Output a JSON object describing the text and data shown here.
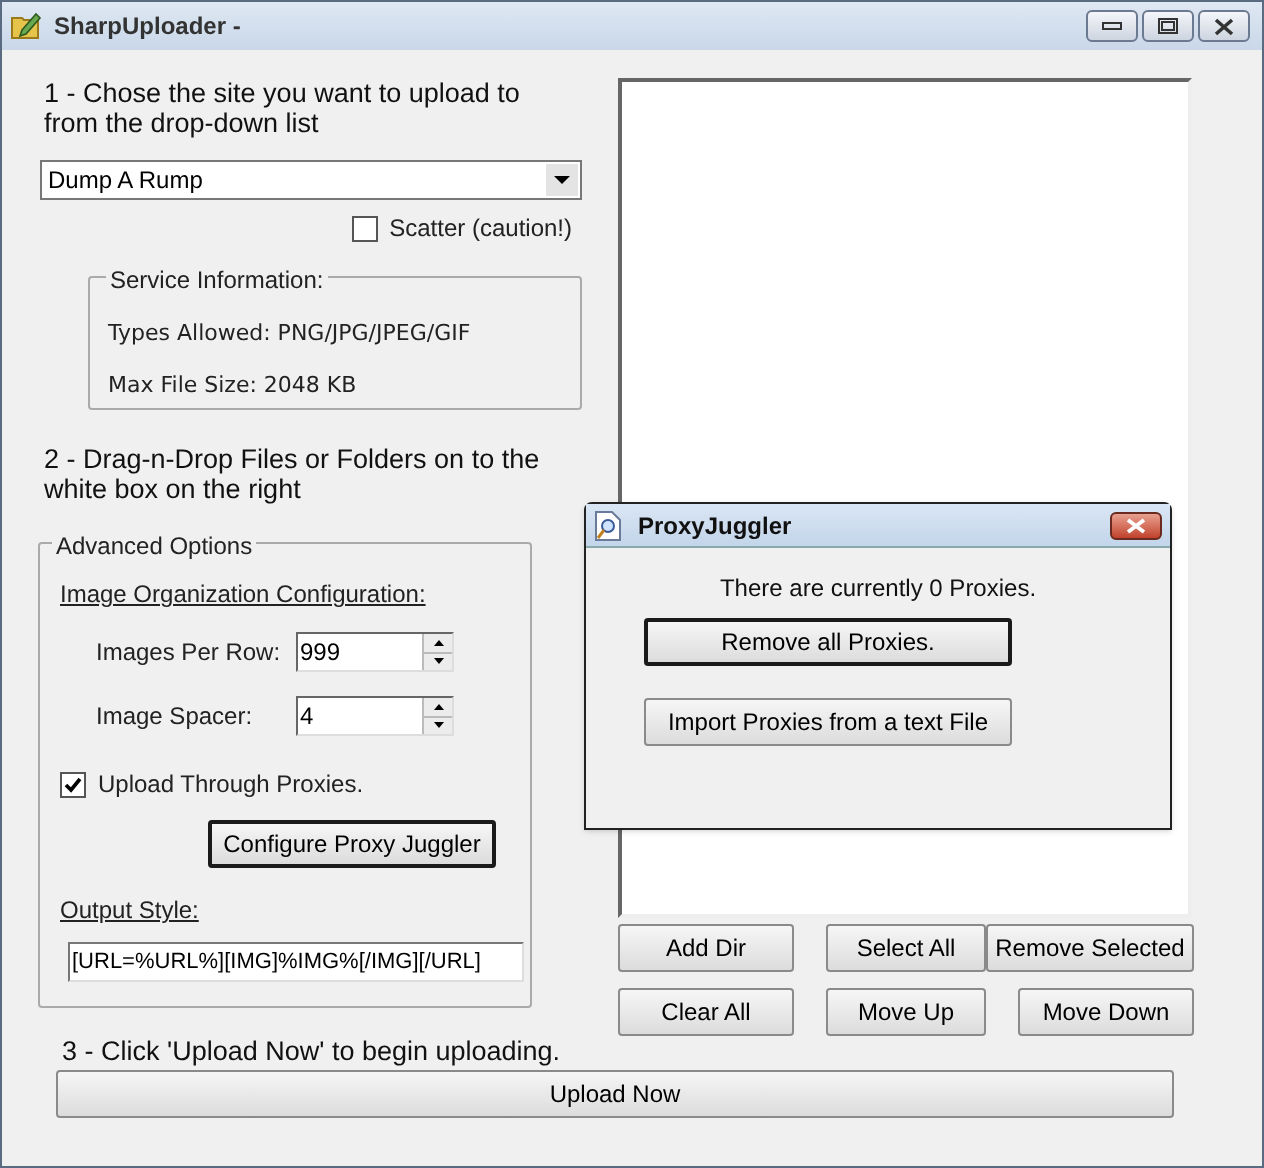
{
  "window": {
    "title": "SharpUploader -"
  },
  "step1": {
    "instruction": "1 - Chose the site you want to upload to from the drop-down list",
    "site_select": {
      "value": "Dump A Rump"
    },
    "scatter": {
      "label": "Scatter (caution!)",
      "checked": false
    }
  },
  "service_info": {
    "title": "Service Information:",
    "types_allowed": "Types Allowed: PNG/JPG/JPEG/GIF",
    "max_file_size": "Max File Size: 2048 KB"
  },
  "step2": {
    "instruction": "2 - Drag-n-Drop Files or Folders on to the white box on the right"
  },
  "advanced_options": {
    "title": "Advanced Options",
    "section_heading": "Image Organization Configuration:",
    "spinners": [
      {
        "label": "Images Per Row:",
        "value": "999"
      },
      {
        "label": "Image Spacer:",
        "value": "4"
      }
    ],
    "upload_through_proxies": {
      "label": "Upload Through Proxies.",
      "checked": true
    },
    "configure_button": {
      "label": "Configure Proxy Juggler",
      "focused": true
    },
    "output_style": {
      "label": "Output Style:",
      "value": "[URL=%URL%][IMG]%IMG%[/IMG][/URL]"
    }
  },
  "file_buttons": [
    {
      "label": "Add Dir"
    },
    {
      "label": "Select All"
    },
    {
      "label": "Remove Selected"
    },
    {
      "label": "Clear All"
    },
    {
      "label": "Move Up"
    },
    {
      "label": "Move Down"
    }
  ],
  "step3": {
    "instruction": "3 - Click 'Upload Now' to begin uploading.",
    "upload_button": "Upload Now"
  },
  "proxy_dialog": {
    "title": "ProxyJuggler",
    "status": "There are currently 0 Proxies.",
    "buttons": [
      {
        "label": "Remove all Proxies.",
        "focused": true
      },
      {
        "label": "Import Proxies from a text File",
        "focused": false
      }
    ]
  }
}
